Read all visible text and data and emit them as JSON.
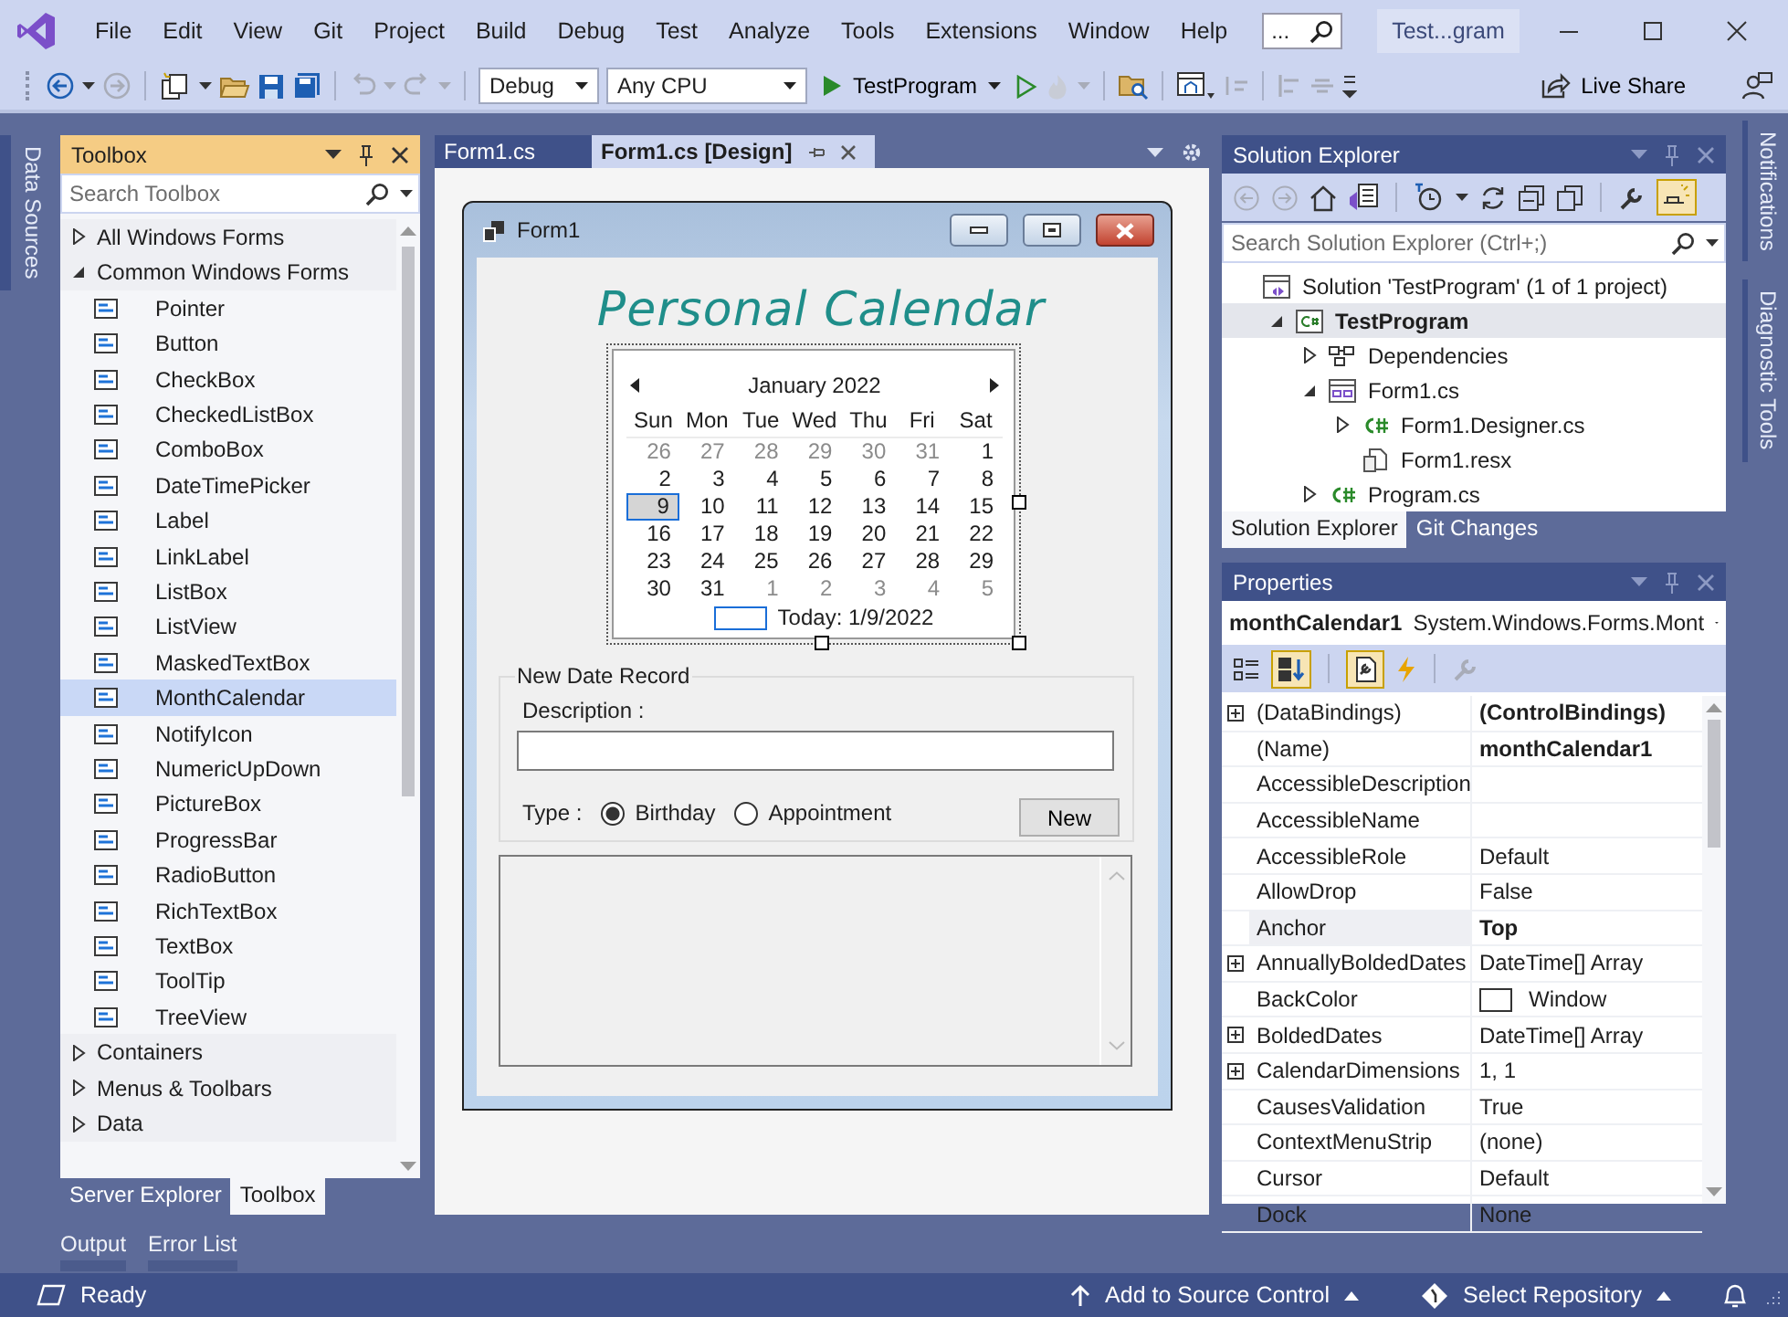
{
  "menu": {
    "items": [
      "File",
      "Edit",
      "View",
      "Git",
      "Project",
      "Build",
      "Debug",
      "Test",
      "Analyze",
      "Tools",
      "Extensions",
      "Window",
      "Help"
    ]
  },
  "quick_search": {
    "value": "..."
  },
  "title": "Test...gram",
  "toolbar": {
    "configuration": "Debug",
    "platform": "Any CPU",
    "start_target": "TestProgram",
    "live_share": "Live Share"
  },
  "left_strip": [
    "Data Sources"
  ],
  "toolbox": {
    "title": "Toolbox",
    "search": {
      "placeholder": "Search Toolbox"
    },
    "groups": [
      {
        "label": "All Windows Forms",
        "expanded": false
      },
      {
        "label": "Common Windows Forms",
        "expanded": true,
        "items": [
          {
            "label": "Pointer",
            "selected": false
          },
          {
            "label": "Button",
            "selected": false
          },
          {
            "label": "CheckBox",
            "selected": false
          },
          {
            "label": "CheckedListBox",
            "selected": false
          },
          {
            "label": "ComboBox",
            "selected": false
          },
          {
            "label": "DateTimePicker",
            "selected": false
          },
          {
            "label": "Label",
            "selected": false
          },
          {
            "label": "LinkLabel",
            "selected": false
          },
          {
            "label": "ListBox",
            "selected": false
          },
          {
            "label": "ListView",
            "selected": false
          },
          {
            "label": "MaskedTextBox",
            "selected": false
          },
          {
            "label": "MonthCalendar",
            "selected": true
          },
          {
            "label": "NotifyIcon",
            "selected": false
          },
          {
            "label": "NumericUpDown",
            "selected": false
          },
          {
            "label": "PictureBox",
            "selected": false
          },
          {
            "label": "ProgressBar",
            "selected": false
          },
          {
            "label": "RadioButton",
            "selected": false
          },
          {
            "label": "RichTextBox",
            "selected": false
          },
          {
            "label": "TextBox",
            "selected": false
          },
          {
            "label": "ToolTip",
            "selected": false
          },
          {
            "label": "TreeView",
            "selected": false
          }
        ]
      },
      {
        "label": "Containers",
        "expanded": false
      },
      {
        "label": "Menus & Toolbars",
        "expanded": false
      },
      {
        "label": "Data",
        "expanded": false
      }
    ],
    "tabs": [
      {
        "label": "Server Explorer",
        "selected": false
      },
      {
        "label": "Toolbox",
        "selected": true
      }
    ]
  },
  "bottom_tabs": [
    "Output",
    "Error List"
  ],
  "editor": {
    "tabs": [
      {
        "label": "Form1.cs",
        "selected": false
      },
      {
        "label": "Form1.cs [Design]",
        "selected": true
      }
    ],
    "form": {
      "title": "Form1",
      "heading": "Personal Calendar",
      "calendar": {
        "month": "January 2022",
        "weekdays": [
          "Sun",
          "Mon",
          "Tue",
          "Wed",
          "Thu",
          "Fri",
          "Sat"
        ],
        "weeks": [
          [
            {
              "day": "26",
              "other_month": true,
              "selected": false
            },
            {
              "day": "27",
              "other_month": true,
              "selected": false
            },
            {
              "day": "28",
              "other_month": true,
              "selected": false
            },
            {
              "day": "29",
              "other_month": true,
              "selected": false
            },
            {
              "day": "30",
              "other_month": true,
              "selected": false
            },
            {
              "day": "31",
              "other_month": true,
              "selected": false
            },
            {
              "day": "1",
              "other_month": false,
              "selected": false
            }
          ],
          [
            {
              "day": "2",
              "other_month": false,
              "selected": false
            },
            {
              "day": "3",
              "other_month": false,
              "selected": false
            },
            {
              "day": "4",
              "other_month": false,
              "selected": false
            },
            {
              "day": "5",
              "other_month": false,
              "selected": false
            },
            {
              "day": "6",
              "other_month": false,
              "selected": false
            },
            {
              "day": "7",
              "other_month": false,
              "selected": false
            },
            {
              "day": "8",
              "other_month": false,
              "selected": false
            }
          ],
          [
            {
              "day": "9",
              "other_month": false,
              "selected": true
            },
            {
              "day": "10",
              "other_month": false,
              "selected": false
            },
            {
              "day": "11",
              "other_month": false,
              "selected": false
            },
            {
              "day": "12",
              "other_month": false,
              "selected": false
            },
            {
              "day": "13",
              "other_month": false,
              "selected": false
            },
            {
              "day": "14",
              "other_month": false,
              "selected": false
            },
            {
              "day": "15",
              "other_month": false,
              "selected": false
            }
          ],
          [
            {
              "day": "16",
              "other_month": false,
              "selected": false
            },
            {
              "day": "17",
              "other_month": false,
              "selected": false
            },
            {
              "day": "18",
              "other_month": false,
              "selected": false
            },
            {
              "day": "19",
              "other_month": false,
              "selected": false
            },
            {
              "day": "20",
              "other_month": false,
              "selected": false
            },
            {
              "day": "21",
              "other_month": false,
              "selected": false
            },
            {
              "day": "22",
              "other_month": false,
              "selected": false
            }
          ],
          [
            {
              "day": "23",
              "other_month": false,
              "selected": false
            },
            {
              "day": "24",
              "other_month": false,
              "selected": false
            },
            {
              "day": "25",
              "other_month": false,
              "selected": false
            },
            {
              "day": "26",
              "other_month": false,
              "selected": false
            },
            {
              "day": "27",
              "other_month": false,
              "selected": false
            },
            {
              "day": "28",
              "other_month": false,
              "selected": false
            },
            {
              "day": "29",
              "other_month": false,
              "selected": false
            }
          ],
          [
            {
              "day": "30",
              "other_month": false,
              "selected": false
            },
            {
              "day": "31",
              "other_month": false,
              "selected": false
            },
            {
              "day": "1",
              "other_month": true,
              "selected": false
            },
            {
              "day": "2",
              "other_month": true,
              "selected": false
            },
            {
              "day": "3",
              "other_month": true,
              "selected": false
            },
            {
              "day": "4",
              "other_month": true,
              "selected": false
            },
            {
              "day": "5",
              "other_month": true,
              "selected": false
            }
          ]
        ],
        "today": "Today: 1/9/2022"
      },
      "group": {
        "title": "New Date Record",
        "description_label": "Description :",
        "type_label": "Type :",
        "radios": [
          {
            "label": "Birthday",
            "selected": true
          },
          {
            "label": "Appointment",
            "selected": false
          }
        ],
        "button": "New"
      }
    }
  },
  "solution_explorer": {
    "title": "Solution Explorer",
    "search": {
      "placeholder": "Search Solution Explorer (Ctrl+;)"
    },
    "tree": [
      {
        "label": "Solution 'TestProgram' (1 of 1 project)",
        "kind": "solution",
        "selected": false,
        "children": [
          {
            "label": "TestProgram",
            "kind": "project",
            "expanded": true,
            "selected": true,
            "children": [
              {
                "label": "Dependencies",
                "kind": "dependencies",
                "expanded": false,
                "selected": false
              },
              {
                "label": "Form1.cs",
                "kind": "form",
                "expanded": true,
                "selected": false,
                "children": [
                  {
                    "label": "Form1.Designer.cs",
                    "kind": "csharp",
                    "expanded": false,
                    "selected": false
                  },
                  {
                    "label": "Form1.resx",
                    "kind": "resource",
                    "selected": false
                  }
                ]
              },
              {
                "label": "Program.cs",
                "kind": "csharp",
                "expanded": false,
                "selected": false
              }
            ]
          }
        ]
      }
    ],
    "tabs": [
      {
        "label": "Solution Explorer",
        "selected": true
      },
      {
        "label": "Git Changes",
        "selected": false
      }
    ]
  },
  "properties": {
    "title": "Properties",
    "object_name": "monthCalendar1",
    "object_type": "System.Windows.Forms.Mont",
    "rows": [
      {
        "name": "(DataBindings)",
        "value": "(ControlBindings)",
        "expandable": true,
        "bold": true,
        "selected": false
      },
      {
        "name": "(Name)",
        "value": "monthCalendar1",
        "expandable": false,
        "bold": true,
        "selected": false
      },
      {
        "name": "AccessibleDescription",
        "expandable": false,
        "selected": false
      },
      {
        "name": "AccessibleName",
        "expandable": false,
        "selected": false
      },
      {
        "name": "AccessibleRole",
        "value": "Default",
        "expandable": false,
        "bold": false,
        "selected": false
      },
      {
        "name": "AllowDrop",
        "value": "False",
        "expandable": false,
        "bold": false,
        "selected": false
      },
      {
        "name": "Anchor",
        "value": "Top",
        "expandable": false,
        "bold": true,
        "selected": true
      },
      {
        "name": "AnnuallyBoldedDates",
        "value": "DateTime[] Array",
        "expandable": true,
        "bold": false,
        "selected": false
      },
      {
        "name": "BackColor",
        "value": "Window",
        "color": "#ffffff",
        "expandable": false,
        "bold": false,
        "selected": false
      },
      {
        "name": "BoldedDates",
        "value": "DateTime[] Array",
        "expandable": true,
        "bold": false,
        "selected": false
      },
      {
        "name": "CalendarDimensions",
        "value": "1, 1",
        "expandable": true,
        "bold": false,
        "selected": false
      },
      {
        "name": "CausesValidation",
        "value": "True",
        "expandable": false,
        "bold": false,
        "selected": false
      },
      {
        "name": "ContextMenuStrip",
        "value": "(none)",
        "expandable": false,
        "bold": false,
        "selected": false
      },
      {
        "name": "Cursor",
        "value": "Default",
        "expandable": false,
        "bold": false,
        "selected": false
      },
      {
        "name": "Dock",
        "value": "None",
        "expandable": false,
        "bold": false,
        "selected": false
      }
    ]
  },
  "right_strip": [
    "Notifications",
    "Diagnostic Tools"
  ],
  "status_bar": {
    "text": "Ready",
    "source_control": "Add to Source Control",
    "repository": "Select Repository"
  }
}
